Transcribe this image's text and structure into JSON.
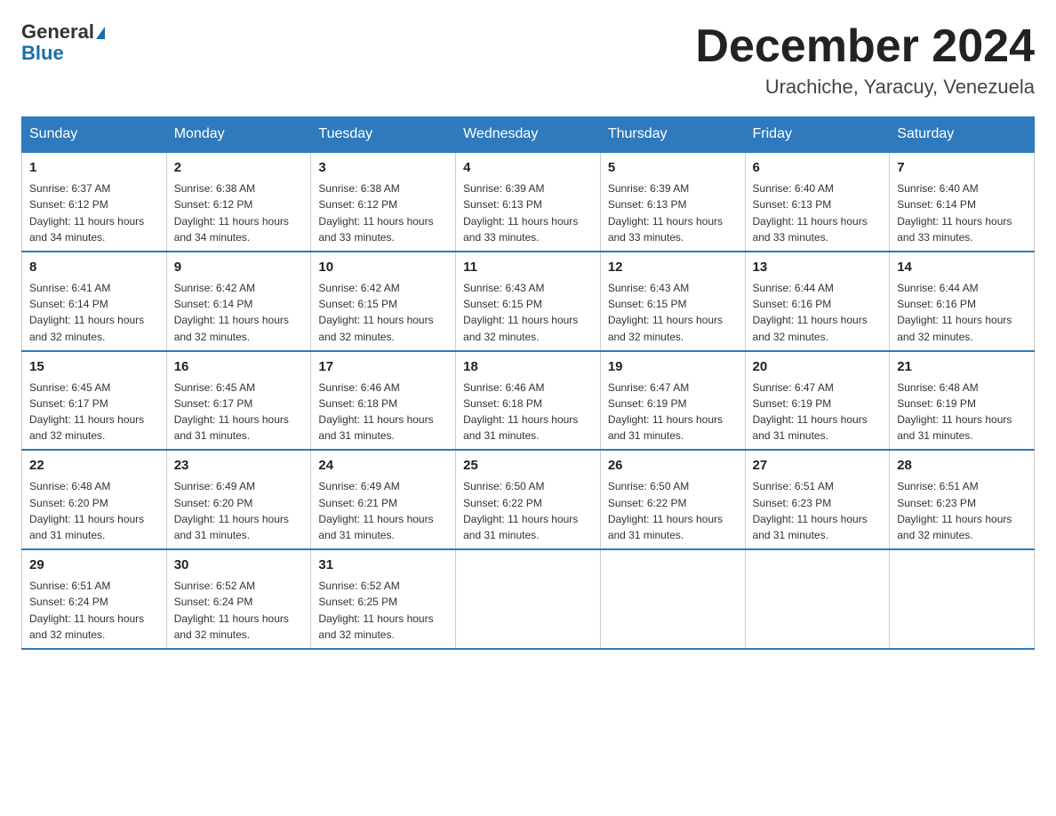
{
  "logo": {
    "line1": "General",
    "line2": "Blue",
    "triangle_label": "logo-triangle"
  },
  "title": "December 2024",
  "subtitle": "Urachiche, Yaracuy, Venezuela",
  "days_header": [
    "Sunday",
    "Monday",
    "Tuesday",
    "Wednesday",
    "Thursday",
    "Friday",
    "Saturday"
  ],
  "weeks": [
    [
      {
        "day": "1",
        "sunrise": "6:37 AM",
        "sunset": "6:12 PM",
        "daylight": "11 hours and 34 minutes."
      },
      {
        "day": "2",
        "sunrise": "6:38 AM",
        "sunset": "6:12 PM",
        "daylight": "11 hours and 34 minutes."
      },
      {
        "day": "3",
        "sunrise": "6:38 AM",
        "sunset": "6:12 PM",
        "daylight": "11 hours and 33 minutes."
      },
      {
        "day": "4",
        "sunrise": "6:39 AM",
        "sunset": "6:13 PM",
        "daylight": "11 hours and 33 minutes."
      },
      {
        "day": "5",
        "sunrise": "6:39 AM",
        "sunset": "6:13 PM",
        "daylight": "11 hours and 33 minutes."
      },
      {
        "day": "6",
        "sunrise": "6:40 AM",
        "sunset": "6:13 PM",
        "daylight": "11 hours and 33 minutes."
      },
      {
        "day": "7",
        "sunrise": "6:40 AM",
        "sunset": "6:14 PM",
        "daylight": "11 hours and 33 minutes."
      }
    ],
    [
      {
        "day": "8",
        "sunrise": "6:41 AM",
        "sunset": "6:14 PM",
        "daylight": "11 hours and 32 minutes."
      },
      {
        "day": "9",
        "sunrise": "6:42 AM",
        "sunset": "6:14 PM",
        "daylight": "11 hours and 32 minutes."
      },
      {
        "day": "10",
        "sunrise": "6:42 AM",
        "sunset": "6:15 PM",
        "daylight": "11 hours and 32 minutes."
      },
      {
        "day": "11",
        "sunrise": "6:43 AM",
        "sunset": "6:15 PM",
        "daylight": "11 hours and 32 minutes."
      },
      {
        "day": "12",
        "sunrise": "6:43 AM",
        "sunset": "6:15 PM",
        "daylight": "11 hours and 32 minutes."
      },
      {
        "day": "13",
        "sunrise": "6:44 AM",
        "sunset": "6:16 PM",
        "daylight": "11 hours and 32 minutes."
      },
      {
        "day": "14",
        "sunrise": "6:44 AM",
        "sunset": "6:16 PM",
        "daylight": "11 hours and 32 minutes."
      }
    ],
    [
      {
        "day": "15",
        "sunrise": "6:45 AM",
        "sunset": "6:17 PM",
        "daylight": "11 hours and 32 minutes."
      },
      {
        "day": "16",
        "sunrise": "6:45 AM",
        "sunset": "6:17 PM",
        "daylight": "11 hours and 31 minutes."
      },
      {
        "day": "17",
        "sunrise": "6:46 AM",
        "sunset": "6:18 PM",
        "daylight": "11 hours and 31 minutes."
      },
      {
        "day": "18",
        "sunrise": "6:46 AM",
        "sunset": "6:18 PM",
        "daylight": "11 hours and 31 minutes."
      },
      {
        "day": "19",
        "sunrise": "6:47 AM",
        "sunset": "6:19 PM",
        "daylight": "11 hours and 31 minutes."
      },
      {
        "day": "20",
        "sunrise": "6:47 AM",
        "sunset": "6:19 PM",
        "daylight": "11 hours and 31 minutes."
      },
      {
        "day": "21",
        "sunrise": "6:48 AM",
        "sunset": "6:19 PM",
        "daylight": "11 hours and 31 minutes."
      }
    ],
    [
      {
        "day": "22",
        "sunrise": "6:48 AM",
        "sunset": "6:20 PM",
        "daylight": "11 hours and 31 minutes."
      },
      {
        "day": "23",
        "sunrise": "6:49 AM",
        "sunset": "6:20 PM",
        "daylight": "11 hours and 31 minutes."
      },
      {
        "day": "24",
        "sunrise": "6:49 AM",
        "sunset": "6:21 PM",
        "daylight": "11 hours and 31 minutes."
      },
      {
        "day": "25",
        "sunrise": "6:50 AM",
        "sunset": "6:22 PM",
        "daylight": "11 hours and 31 minutes."
      },
      {
        "day": "26",
        "sunrise": "6:50 AM",
        "sunset": "6:22 PM",
        "daylight": "11 hours and 31 minutes."
      },
      {
        "day": "27",
        "sunrise": "6:51 AM",
        "sunset": "6:23 PM",
        "daylight": "11 hours and 31 minutes."
      },
      {
        "day": "28",
        "sunrise": "6:51 AM",
        "sunset": "6:23 PM",
        "daylight": "11 hours and 32 minutes."
      }
    ],
    [
      {
        "day": "29",
        "sunrise": "6:51 AM",
        "sunset": "6:24 PM",
        "daylight": "11 hours and 32 minutes."
      },
      {
        "day": "30",
        "sunrise": "6:52 AM",
        "sunset": "6:24 PM",
        "daylight": "11 hours and 32 minutes."
      },
      {
        "day": "31",
        "sunrise": "6:52 AM",
        "sunset": "6:25 PM",
        "daylight": "11 hours and 32 minutes."
      },
      null,
      null,
      null,
      null
    ]
  ],
  "labels": {
    "sunrise": "Sunrise:",
    "sunset": "Sunset:",
    "daylight": "Daylight:"
  },
  "colors": {
    "header_bg": "#2e7abd",
    "header_text": "#ffffff",
    "border_top": "#2e7abd"
  }
}
